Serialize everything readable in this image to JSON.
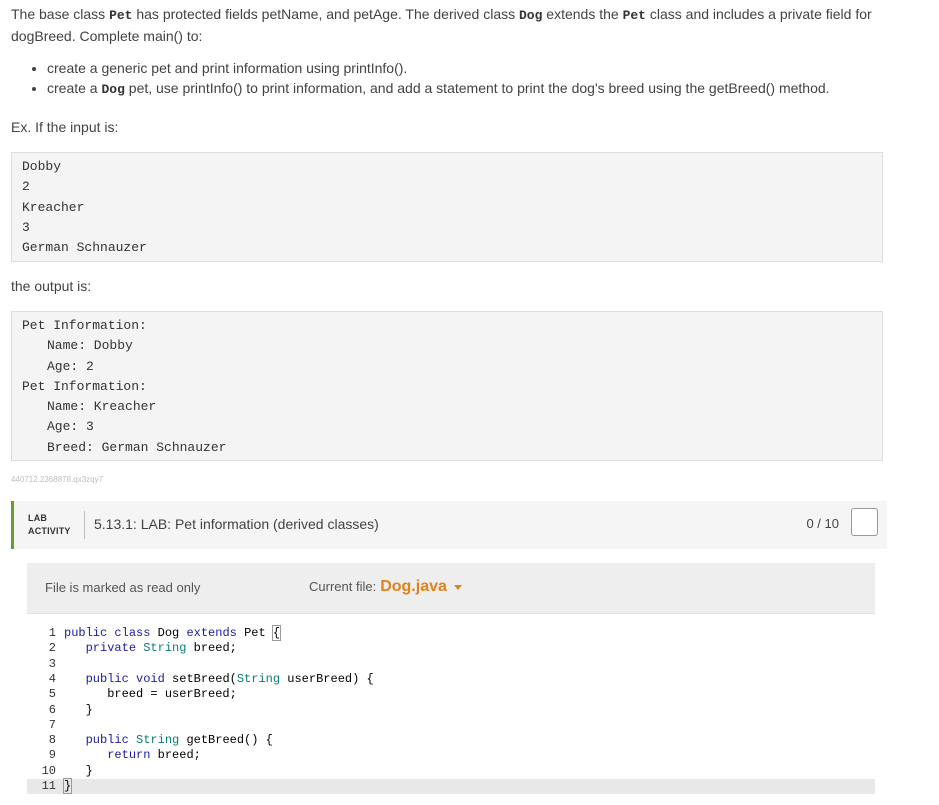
{
  "prose": {
    "p1_a": "The base class ",
    "p1_pet": "Pet",
    "p1_b": " has protected fields petName, and petAge. The derived class ",
    "p1_dog": "Dog",
    "p1_c": " extends the ",
    "p1_pet2": "Pet",
    "p1_d": " class and includes a private field for dogBreed. Complete main() to:",
    "bullet1": "create a generic pet and print information using printInfo().",
    "bullet2_a": "create a ",
    "bullet2_dog": "Dog",
    "bullet2_b": " pet, use printInfo() to print information, and add a statement to print the dog's breed using the getBreed() method.",
    "example_label": "Ex. If the input is:",
    "output_label": "the output is:"
  },
  "input_lines": [
    "Dobby",
    "2",
    "Kreacher",
    "3",
    "German Schnauzer"
  ],
  "output_lines": [
    {
      "text": "Pet Information:",
      "indent": false
    },
    {
      "text": "Name: Dobby",
      "indent": true
    },
    {
      "text": "Age: 2",
      "indent": true
    },
    {
      "text": "Pet Information:",
      "indent": false
    },
    {
      "text": "Name: Kreacher",
      "indent": true
    },
    {
      "text": "Age: 3",
      "indent": true
    },
    {
      "text": "Breed: German Schnauzer",
      "indent": true
    }
  ],
  "tracking_id": "440712.2368878.qx3zqy7",
  "lab": {
    "tag_line1": "LAB",
    "tag_line2": "ACTIVITY",
    "title": "5.13.1: LAB: Pet information (derived classes)",
    "score": "0 / 10"
  },
  "ide": {
    "readonly_text": "File is marked as read only",
    "current_file_label": "Current file:",
    "current_file_name": "Dog.java"
  },
  "code_lines": [
    "1",
    "2",
    "3",
    "4",
    "5",
    "6",
    "7",
    "8",
    "9",
    "10",
    "11"
  ],
  "colors": {
    "accent_green": "#6a9b34",
    "file_orange": "#e0821e",
    "keyword_blue": "#1a1aa6",
    "type_teal": "#0b7d75"
  }
}
